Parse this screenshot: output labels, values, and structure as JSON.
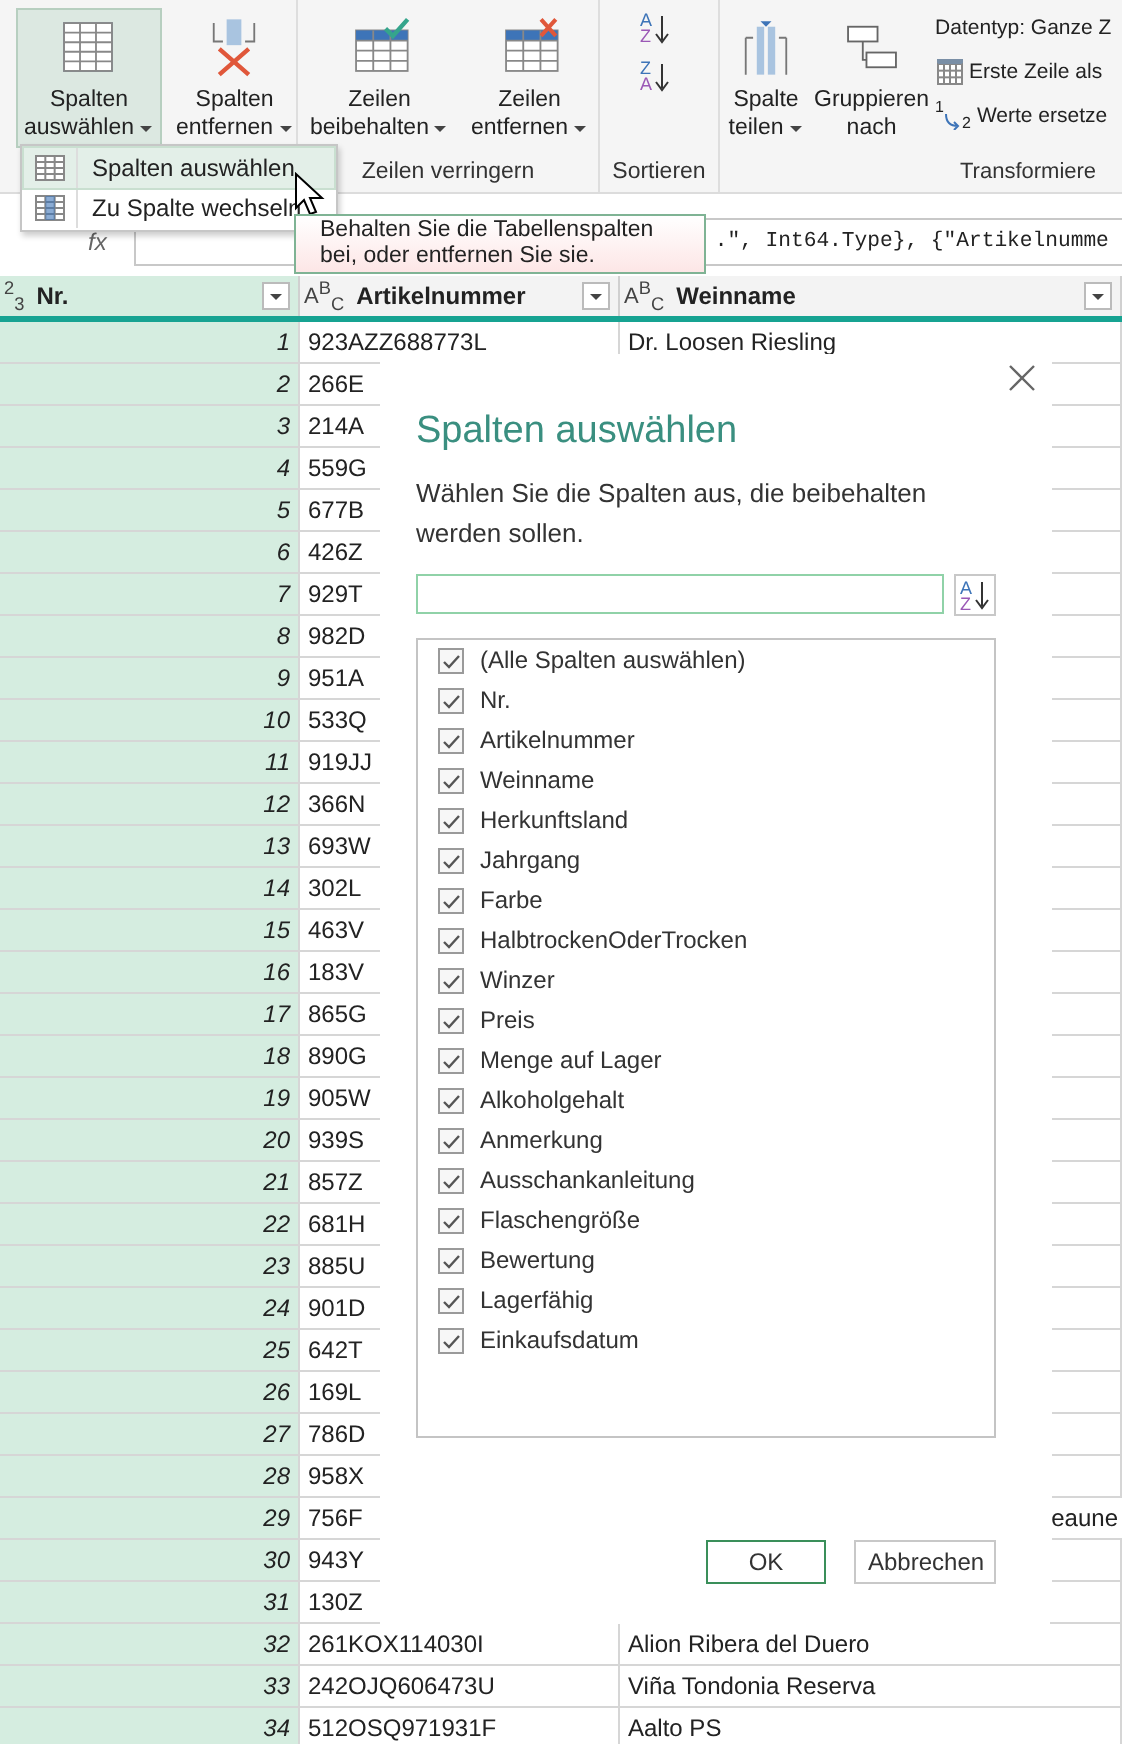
{
  "ribbon": {
    "groups": [
      {
        "buttons": [
          {
            "lines": [
              "Spalten",
              "auswählen"
            ],
            "dropdown": true,
            "selected": true
          },
          {
            "lines": [
              "Spalten",
              "entfernen"
            ],
            "dropdown": true,
            "selected": false
          }
        ]
      },
      {
        "label": "Zeilen verringern",
        "buttons": [
          {
            "lines": [
              "Zeilen",
              "beibehalten"
            ],
            "dropdown": true,
            "selected": false
          },
          {
            "lines": [
              "Zeilen",
              "entfernen"
            ],
            "dropdown": true,
            "selected": false
          }
        ]
      },
      {
        "label": "Sortieren",
        "sort_icons": [
          [
            "A",
            "Z"
          ],
          [
            "Z",
            "A"
          ]
        ]
      },
      {
        "label": "Transformiere",
        "buttons": [
          {
            "lines": [
              "Spalte",
              "teilen"
            ],
            "dropdown": true,
            "selected": false
          },
          {
            "lines": [
              "Gruppieren",
              "nach"
            ],
            "dropdown": false,
            "selected": false
          }
        ],
        "small": [
          {
            "label": "Datentyp: Ganze Z",
            "kind": "plain"
          },
          {
            "label": "Erste Zeile als",
            "kind": "calendar"
          },
          {
            "label": "Werte ersetze",
            "kind": "replace",
            "icon_text": [
              "1",
              "2"
            ]
          }
        ]
      }
    ]
  },
  "menu": {
    "items": [
      {
        "label": "Spalten auswählen",
        "selected": true
      },
      {
        "label": "Zu Spalte wechseln",
        "selected": false
      }
    ]
  },
  "tooltip": "Behalten Sie die Tabellenspalten bei, oder entfernen Sie sie.",
  "formula_bar": {
    "fx": "fx",
    "formula": ".\", Int64.Type}, {\"Artikelnumme"
  },
  "table": {
    "columns": [
      {
        "name": "Nr.",
        "type": "$^{2}$$_{3}$",
        "selected": true
      },
      {
        "name": "Artikelnummer",
        "type": "A$^{B}$$_{C}$",
        "selected": false
      },
      {
        "name": "Weinname",
        "type": "A$^{B}$$_{C}$",
        "selected": false
      }
    ],
    "rows": [
      {
        "nr": "1",
        "artikel": "923AZZ688773L",
        "wein": "Dr. Loosen Riesling"
      },
      {
        "nr": "2",
        "artikel": "266E"
      },
      {
        "nr": "3",
        "artikel": "214A"
      },
      {
        "nr": "4",
        "artikel": "559G"
      },
      {
        "nr": "5",
        "artikel": "677B"
      },
      {
        "nr": "6",
        "artikel": "426Z"
      },
      {
        "nr": "7",
        "artikel": "929T"
      },
      {
        "nr": "8",
        "artikel": "982D"
      },
      {
        "nr": "9",
        "artikel": "951A"
      },
      {
        "nr": "10",
        "artikel": "533Q"
      },
      {
        "nr": "11",
        "artikel": "919JJ"
      },
      {
        "nr": "12",
        "artikel": "366N"
      },
      {
        "nr": "13",
        "artikel": "693W"
      },
      {
        "nr": "14",
        "artikel": "302L"
      },
      {
        "nr": "15",
        "artikel": "463V"
      },
      {
        "nr": "16",
        "artikel": "183V"
      },
      {
        "nr": "17",
        "artikel": "865G"
      },
      {
        "nr": "18",
        "artikel": "890G"
      },
      {
        "nr": "19",
        "artikel": "905W"
      },
      {
        "nr": "20",
        "artikel": "939S"
      },
      {
        "nr": "21",
        "artikel": "857Z"
      },
      {
        "nr": "22",
        "artikel": "681H"
      },
      {
        "nr": "23",
        "artikel": "885U"
      },
      {
        "nr": "24",
        "artikel": "901D"
      },
      {
        "nr": "25",
        "artikel": "642T"
      },
      {
        "nr": "26",
        "artikel": "169L"
      },
      {
        "nr": "27",
        "artikel": "786D"
      },
      {
        "nr": "28",
        "artikel": "958X"
      },
      {
        "nr": "29",
        "artikel": "756F",
        "wein": "eaune",
        "wein_clipped": true
      },
      {
        "nr": "30",
        "artikel": "943Y"
      },
      {
        "nr": "31",
        "artikel": "130Z"
      },
      {
        "nr": "32",
        "artikel": "261KOX114030I",
        "wein": "Alion Ribera del Duero"
      },
      {
        "nr": "33",
        "artikel": "242OJQ606473U",
        "wein": "Viña Tondonia Reserva"
      },
      {
        "nr": "34",
        "artikel": "512OSQ971931F",
        "wein": "Aalto PS"
      }
    ]
  },
  "dialog": {
    "title": "Spalten auswählen",
    "description": "Wählen Sie die Spalten aus, die beibehalten werden sollen.",
    "sort_letters": [
      "A",
      "Z"
    ],
    "items": [
      {
        "label": "(Alle Spalten auswählen)",
        "checked": true
      },
      {
        "label": "Nr.",
        "checked": true
      },
      {
        "label": "Artikelnummer",
        "checked": true
      },
      {
        "label": "Weinname",
        "checked": true
      },
      {
        "label": "Herkunftsland",
        "checked": true
      },
      {
        "label": "Jahrgang",
        "checked": true
      },
      {
        "label": "Farbe",
        "checked": true
      },
      {
        "label": "HalbtrockenOderTrocken",
        "checked": true
      },
      {
        "label": "Winzer",
        "checked": true
      },
      {
        "label": "Preis",
        "checked": true
      },
      {
        "label": "Menge auf Lager",
        "checked": true
      },
      {
        "label": "Alkoholgehalt",
        "checked": true
      },
      {
        "label": "Anmerkung",
        "checked": true
      },
      {
        "label": "Ausschankanleitung",
        "checked": true
      },
      {
        "label": "Flaschengröße",
        "checked": true
      },
      {
        "label": "Bewertung",
        "checked": true
      },
      {
        "label": "Lagerfähig",
        "checked": true
      },
      {
        "label": "Einkaufsdatum",
        "checked": true
      }
    ],
    "buttons": [
      {
        "label": "OK",
        "kind": "primary"
      },
      {
        "label": "Abbrechen",
        "kind": "secondary"
      }
    ]
  }
}
